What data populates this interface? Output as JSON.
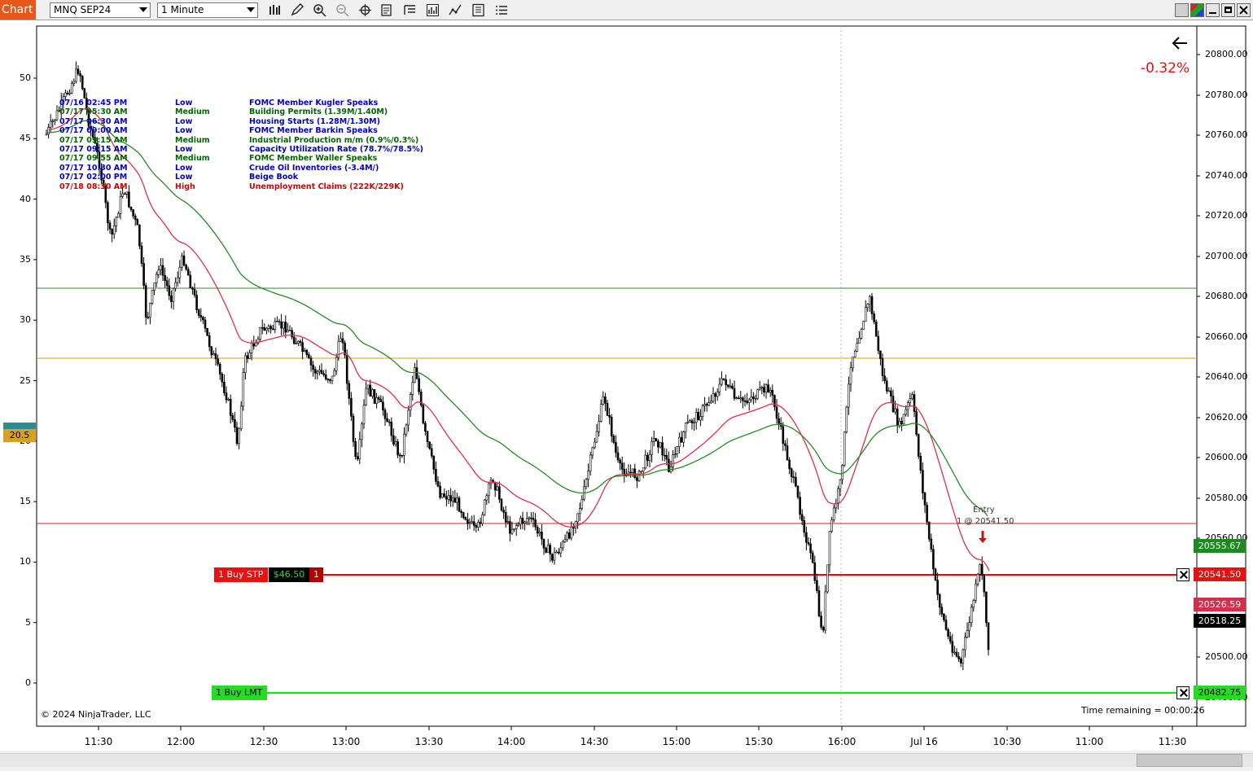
{
  "toolbar": {
    "tab_label": "Chart",
    "instrument": "MNQ SEP24",
    "interval": "1 Minute",
    "icons": [
      "bar-type-icon",
      "pencil-draw-icon",
      "zoom-in-icon",
      "zoom-out-icon",
      "crosshair-icon",
      "data-box-icon",
      "properties-icon",
      "indicators-icon",
      "strategies-icon",
      "templates-icon",
      "menu-list-icon"
    ]
  },
  "chart": {
    "change_pct": "-0.32%",
    "copyright": "© 2024 NinjaTrader, LLC",
    "time_remaining": "Time remaining = 00:00:26",
    "left_axis_ticks": [
      "50",
      "45",
      "40",
      "35",
      "30",
      "25",
      "20",
      "15",
      "10",
      "5",
      "0"
    ],
    "right_axis_ticks": [
      "20800.00",
      "20780.00",
      "20760.00",
      "20740.00",
      "20720.00",
      "20700.00",
      "20680.00",
      "20660.00",
      "20640.00",
      "20620.00",
      "20600.00",
      "20580.00",
      "20560.00",
      "20500.00",
      "20480.00"
    ],
    "x_axis_ticks": [
      "11:30",
      "12:00",
      "12:30",
      "13:00",
      "13:30",
      "14:00",
      "14:30",
      "15:00",
      "15:30",
      "16:00",
      "Jul 16",
      "10:30",
      "11:00",
      "11:30"
    ],
    "left_marker_value": "20.5",
    "news": [
      {
        "date": "07/16 02:45 PM",
        "impact": "Low",
        "event": "FOMC Member Kugler Speaks",
        "color": "#0000cc"
      },
      {
        "date": "07/17 05:30 AM",
        "impact": "Medium",
        "event": "Building Permits (1.39M/1.40M)",
        "color": "#006600"
      },
      {
        "date": "07/17 06:30 AM",
        "impact": "Low",
        "event": "Housing Starts (1.28M/1.30M)",
        "color": "#0000cc"
      },
      {
        "date": "07/17 09:00 AM",
        "impact": "Low",
        "event": "FOMC Member Barkin Speaks",
        "color": "#0000cc"
      },
      {
        "date": "07/17 09:15 AM",
        "impact": "Medium",
        "event": "Industrial Production m/m (0.9%/0.3%)",
        "color": "#006600"
      },
      {
        "date": "07/17 09:15 AM",
        "impact": "Low",
        "event": "Capacity Utilization Rate (78.7%/78.5%)",
        "color": "#0000cc"
      },
      {
        "date": "07/17 09:55 AM",
        "impact": "Medium",
        "event": "FOMC Member Waller Speaks",
        "color": "#006600"
      },
      {
        "date": "07/17 10:30 AM",
        "impact": "Low",
        "event": "Crude Oil Inventories (-3.4M/)",
        "color": "#0000cc"
      },
      {
        "date": "07/17 02:00 PM",
        "impact": "Low",
        "event": "Beige Book",
        "color": "#0000cc"
      },
      {
        "date": "07/18 08:30 AM",
        "impact": "High",
        "event": "Unemployment Claims (222K/229K)",
        "color": "#dd0000"
      }
    ],
    "orders": {
      "buy_stp": {
        "label": "1  Buy STP",
        "pnl": "$46.50",
        "qty": "1",
        "price": "20541.50"
      },
      "buy_lmt": {
        "label": "1  Buy LMT",
        "price": "20482.75"
      }
    },
    "entry": {
      "label": "Entry",
      "detail": "1 @ 20541.50"
    },
    "price_tags": {
      "ema_slow": "20555.67",
      "ema_fast": "20526.59",
      "last": "20518.25"
    },
    "colors": {
      "stop_line": "#ff0000",
      "limit_line": "#00ee00",
      "ema_slow": "#228b22",
      "ema_fast": "#e0304a",
      "resistance": "#2e8b2e",
      "level_orange": "#d4a017",
      "level_red": "#cc2222"
    }
  }
}
